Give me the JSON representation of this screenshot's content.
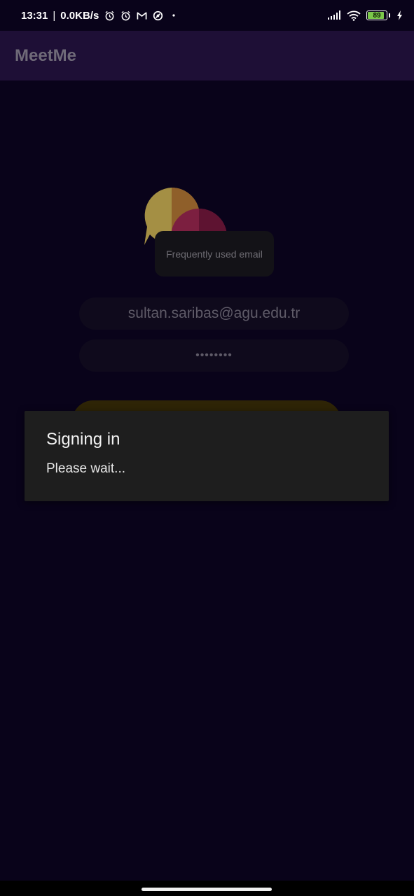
{
  "status_bar": {
    "time": "13:31",
    "separator": "|",
    "network_speed": "0.0KB/s",
    "battery_level": "89",
    "battery_fraction": 0.89,
    "icons": [
      "alarm-icon",
      "alarm-icon",
      "gmail-icon",
      "sync-icon",
      "dot-icon",
      "signal-icon",
      "wifi-icon",
      "battery-icon",
      "charging-icon"
    ],
    "battery_color": "#7cc94b"
  },
  "app_bar": {
    "title": "MeetMe",
    "background": "#1e0f36"
  },
  "logo": {
    "icon": "chat-bubbles-icon",
    "colors": [
      "#b09a48",
      "#9a6a2c",
      "#8a2244",
      "#6a1030"
    ]
  },
  "tooltip": {
    "text": "Frequently used email"
  },
  "login_form": {
    "email_value": "sultan.saribas@agu.edu.tr",
    "password_value": "••••••••",
    "signin_button_color": "#2e2406"
  },
  "dialog": {
    "title": "Signing in",
    "message": "Please wait..."
  }
}
